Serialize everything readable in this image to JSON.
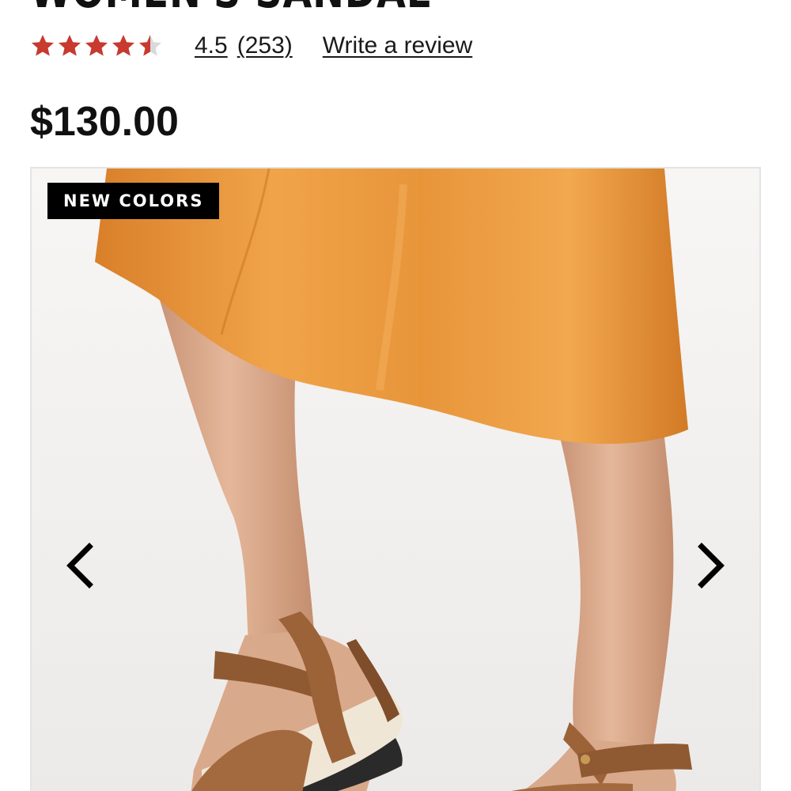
{
  "product": {
    "title": "WOMEN'S SANDAL",
    "price": "$130.00"
  },
  "rating": {
    "stars": 4.5,
    "max_stars": 5,
    "value": "4.5",
    "review_count": "(253)",
    "write_review_label": "Write a review",
    "star_color": "#c8392e",
    "star_empty_color": "#d9d9d9"
  },
  "gallery": {
    "badge": "NEW COLORS",
    "prev_icon": "chevron-left-icon",
    "next_icon": "chevron-right-icon",
    "image_alt": "Model wearing orange satin skirt and tan leather platform sandals"
  }
}
